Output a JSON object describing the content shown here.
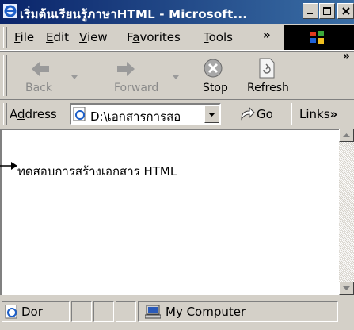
{
  "window": {
    "title": "เริ่มต้นเรียนรู้ภาษาHTML - Microsoft..."
  },
  "menu": {
    "items": [
      {
        "label": "File",
        "key": "F",
        "rest": "ile"
      },
      {
        "label": "Edit",
        "key": "E",
        "rest": "dit"
      },
      {
        "label": "View",
        "key": "V",
        "rest": "iew"
      },
      {
        "label": "Favorites",
        "key_pre": "F",
        "key": "a",
        "rest": "vorites"
      },
      {
        "label": "Tools",
        "key": "T",
        "rest": "ools"
      }
    ],
    "overflow": "»"
  },
  "toolbar": {
    "back_label": "Back",
    "forward_label": "Forward",
    "stop_label": "Stop",
    "refresh_label": "Refresh",
    "overflow": "»"
  },
  "address": {
    "label_pre": "A",
    "label_key": "d",
    "label_rest": "dress",
    "value": "D:\\เอกสารการสอ",
    "go_label": "Go",
    "links_label": "Links",
    "links_overflow": "»"
  },
  "content": {
    "text": "ทดสอบการสร้างเอกสาร HTML"
  },
  "status": {
    "text": "Dor",
    "zone_label": "My Computer"
  },
  "colors": {
    "title_start": "#0a246a",
    "title_end": "#3a6ea5",
    "chrome": "#d4d0c8"
  }
}
